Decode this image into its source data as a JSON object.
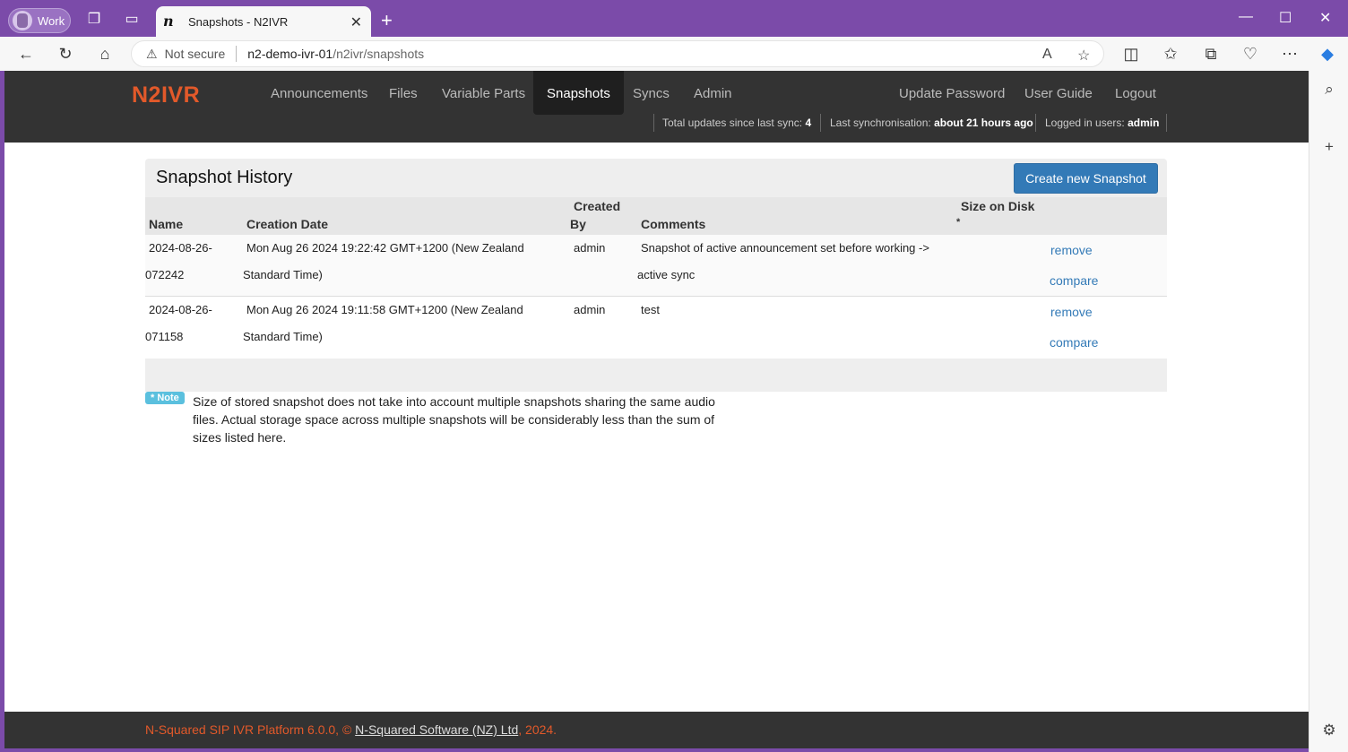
{
  "browser": {
    "profile_label": "Work",
    "tab_title": "Snapshots - N2IVR",
    "tab_favicon": "n",
    "security_label": "Not secure",
    "url_host": "n2-demo-ivr-01",
    "url_path": "/n2ivr/snapshots"
  },
  "navbar": {
    "brand": "N2IVR",
    "links": [
      "Announcements",
      "Files",
      "Variable Parts",
      "Snapshots",
      "Syncs",
      "Admin"
    ],
    "right_links": [
      "Update Password",
      "User Guide",
      "Logout"
    ],
    "status": {
      "updates_label": "Total updates since last sync:",
      "updates_value": "4",
      "sync_label": "Last synchronisation:",
      "sync_value": "about 21 hours ago",
      "users_label": "Logged in users:",
      "users_value": "admin"
    }
  },
  "panel": {
    "title": "Snapshot History",
    "create_button": "Create new Snapshot",
    "headers": {
      "name": "Name",
      "creation_date": "Creation Date",
      "created_by_1": "Created",
      "created_by_2": "By",
      "comments": "Comments",
      "size": "Size on Disk",
      "size_star": "*"
    },
    "rows": [
      {
        "name_1": "2024-08-26-",
        "name_2": "072242",
        "date_1": "Mon Aug 26 2024 19:22:42 GMT+1200 (New Zealand",
        "date_2": "Standard Time)",
        "by": "admin",
        "comment_1": "Snapshot of active announcement set before working ->",
        "comment_2": "active sync",
        "remove": "remove",
        "compare": "compare"
      },
      {
        "name_1": "2024-08-26-",
        "name_2": "071158",
        "date_1": "Mon Aug 26 2024 19:11:58 GMT+1200 (New Zealand",
        "date_2": "Standard Time)",
        "by": "admin",
        "comment_1": "test",
        "comment_2": "",
        "remove": "remove",
        "compare": "compare"
      }
    ]
  },
  "note": {
    "label": "* Note",
    "text": "Size of stored snapshot does not take into account multiple snapshots sharing the same audio files. Actual storage space across multiple snapshots will be considerably less than the sum of sizes listed here."
  },
  "footer": {
    "prefix": "N-Squared SIP IVR Platform 6.0.0, © ",
    "link": "N-Squared Software (NZ) Ltd",
    "suffix": ", 2024."
  }
}
